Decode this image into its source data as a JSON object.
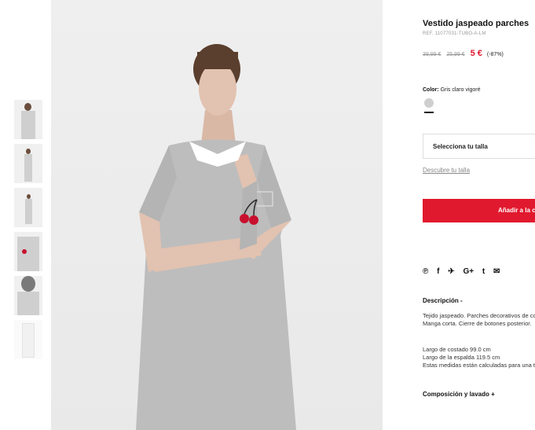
{
  "product": {
    "title": "Vestido jaspeado parches",
    "ref": "REF. 11077031-TUBO-A-LM",
    "price_original": "39,99 €",
    "price_previous": "25,99 €",
    "price_current": "5 €",
    "discount": "(-87%)"
  },
  "color": {
    "label": "Color:",
    "value": "Gris claro vigoré",
    "swatch_color": "#cfcfcf"
  },
  "size": {
    "select_label": "Selecciona tu talla",
    "guide_link": "Descubre tu talla"
  },
  "cart": {
    "add_label": "Añadir a la cesta"
  },
  "social": {
    "icons": [
      "pinterest-icon",
      "facebook-icon",
      "twitter-icon",
      "google-plus-icon",
      "tumblr-icon",
      "email-icon"
    ],
    "glyphs": [
      "℗",
      "f",
      "🐦",
      "G+",
      "t",
      "✉"
    ]
  },
  "description": {
    "heading": "Descripción -",
    "text": "Tejido jaspeado. Parches decorativos de contraste. Manga corta. Cierre de botones posterior.",
    "line1": "Largo de costado 99.0 cm",
    "line2": "Largo de la espalda 119.5 cm",
    "line3": "Estas medidas están calculadas para una talla M"
  },
  "composition": {
    "heading": "Composición y lavado +"
  },
  "colors": {
    "accent": "#e1192e",
    "dress": "#bdbdbd",
    "collar": "#ffffff",
    "cherry": "#c8102e"
  }
}
